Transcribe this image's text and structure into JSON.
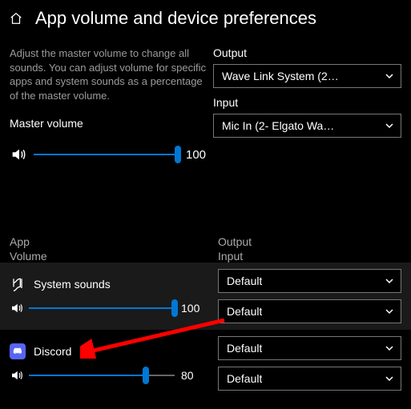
{
  "header": {
    "title": "App volume and device preferences"
  },
  "description": "Adjust the master volume to change all sounds. You can adjust volume for specific apps and system sounds as a percentage of the master volume.",
  "master": {
    "label": "Master volume",
    "value": "100",
    "percent": 100
  },
  "output": {
    "label": "Output",
    "selected": "Wave Link System (2…"
  },
  "input": {
    "label": "Input",
    "selected": "Mic In (2- Elgato Wa…"
  },
  "columns": {
    "app": "App",
    "volume": "Volume",
    "output": "Output",
    "input": "Input"
  },
  "apps": {
    "system": {
      "name": "System sounds",
      "value": "100",
      "percent": 100,
      "output": "Default",
      "input": "Default"
    },
    "discord": {
      "name": "Discord",
      "value": "80",
      "percent": 80,
      "output": "Default",
      "input": "Default"
    }
  }
}
